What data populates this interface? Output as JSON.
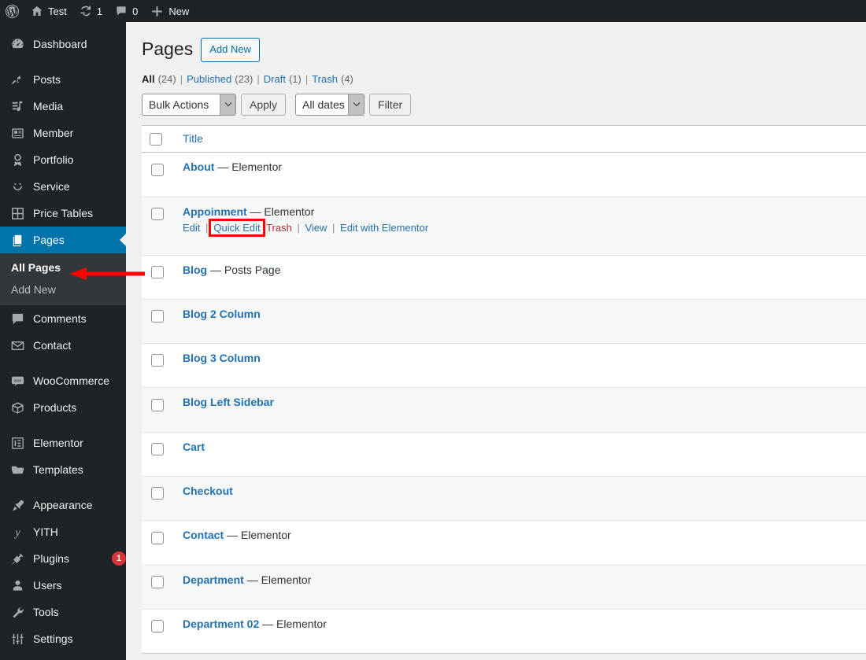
{
  "adminbar": {
    "items": [
      {
        "icon": "wordpress-logo-icon",
        "label": ""
      },
      {
        "icon": "home-icon",
        "label": "Test"
      },
      {
        "icon": "update-icon",
        "label": "1"
      },
      {
        "icon": "comment-icon",
        "label": "0"
      },
      {
        "icon": "plus-icon",
        "label": "New"
      }
    ]
  },
  "sidebar": {
    "items": [
      {
        "label": "Dashboard",
        "icon": "dashboard-icon",
        "sep_after": true
      },
      {
        "label": "Posts",
        "icon": "pin-icon"
      },
      {
        "label": "Media",
        "icon": "media-icon"
      },
      {
        "label": "Member",
        "icon": "member-card-icon"
      },
      {
        "label": "Portfolio",
        "icon": "award-icon"
      },
      {
        "label": "Service",
        "icon": "smiley-icon"
      },
      {
        "label": "Price Tables",
        "icon": "grid-icon"
      },
      {
        "label": "Pages",
        "icon": "pages-icon",
        "current": true
      },
      {
        "label": "Comments",
        "icon": "comment-icon"
      },
      {
        "label": "Contact",
        "icon": "envelope-icon",
        "sep_after": true
      },
      {
        "label": "WooCommerce",
        "icon": "woocommerce-icon"
      },
      {
        "label": "Products",
        "icon": "box-icon",
        "sep_after": true
      },
      {
        "label": "Elementor",
        "icon": "elementor-icon"
      },
      {
        "label": "Templates",
        "icon": "folder-icon",
        "sep_after": true
      },
      {
        "label": "Appearance",
        "icon": "brush-icon"
      },
      {
        "label": "YITH",
        "icon": "yith-icon"
      },
      {
        "label": "Plugins",
        "icon": "plug-icon",
        "badge": "1"
      },
      {
        "label": "Users",
        "icon": "user-icon"
      },
      {
        "label": "Tools",
        "icon": "wrench-icon"
      },
      {
        "label": "Settings",
        "icon": "sliders-icon"
      }
    ],
    "submenu": [
      {
        "label": "All Pages",
        "current": true
      },
      {
        "label": "Add New",
        "current": false
      }
    ]
  },
  "page": {
    "title": "Pages",
    "add_new_label": "Add New"
  },
  "filters": {
    "links": [
      {
        "label": "All",
        "count": "(24)",
        "current": true
      },
      {
        "label": "Published",
        "count": "(23)",
        "current": false
      },
      {
        "label": "Draft",
        "count": "(1)",
        "current": false
      },
      {
        "label": "Trash",
        "count": "(4)",
        "current": false
      }
    ],
    "separator": "|"
  },
  "tablenav": {
    "bulk_actions_value": "Bulk Actions",
    "apply_label": "Apply",
    "dates_value": "All dates",
    "filter_label": "Filter"
  },
  "table": {
    "columns": {
      "title": "Title"
    },
    "rows": [
      {
        "title": "About",
        "state": "— Elementor",
        "alt": false,
        "actions": false
      },
      {
        "title": "Appoinment",
        "state": "— Elementor",
        "alt": true,
        "actions": true
      },
      {
        "title": "Blog",
        "state": "— Posts Page",
        "alt": false,
        "actions": false
      },
      {
        "title": "Blog 2 Column",
        "state": "",
        "alt": true,
        "actions": false
      },
      {
        "title": "Blog 3 Column",
        "state": "",
        "alt": false,
        "actions": false
      },
      {
        "title": "Blog Left Sidebar",
        "state": "",
        "alt": true,
        "actions": false
      },
      {
        "title": "Cart",
        "state": "",
        "alt": false,
        "actions": false
      },
      {
        "title": "Checkout",
        "state": "",
        "alt": true,
        "actions": false
      },
      {
        "title": "Contact",
        "state": "— Elementor",
        "alt": false,
        "actions": false
      },
      {
        "title": "Department",
        "state": "— Elementor",
        "alt": true,
        "actions": false
      },
      {
        "title": "Department 02",
        "state": "— Elementor",
        "alt": false,
        "actions": false
      }
    ],
    "row_actions": {
      "edit": "Edit",
      "quick_edit": "Quick Edit",
      "trash": "Trash",
      "view": "View",
      "edit_with_elementor": "Edit with Elementor",
      "separator": "|"
    }
  },
  "annotations": {
    "highlight_color": "#ff0000",
    "arrow_color": "#ff0000"
  }
}
